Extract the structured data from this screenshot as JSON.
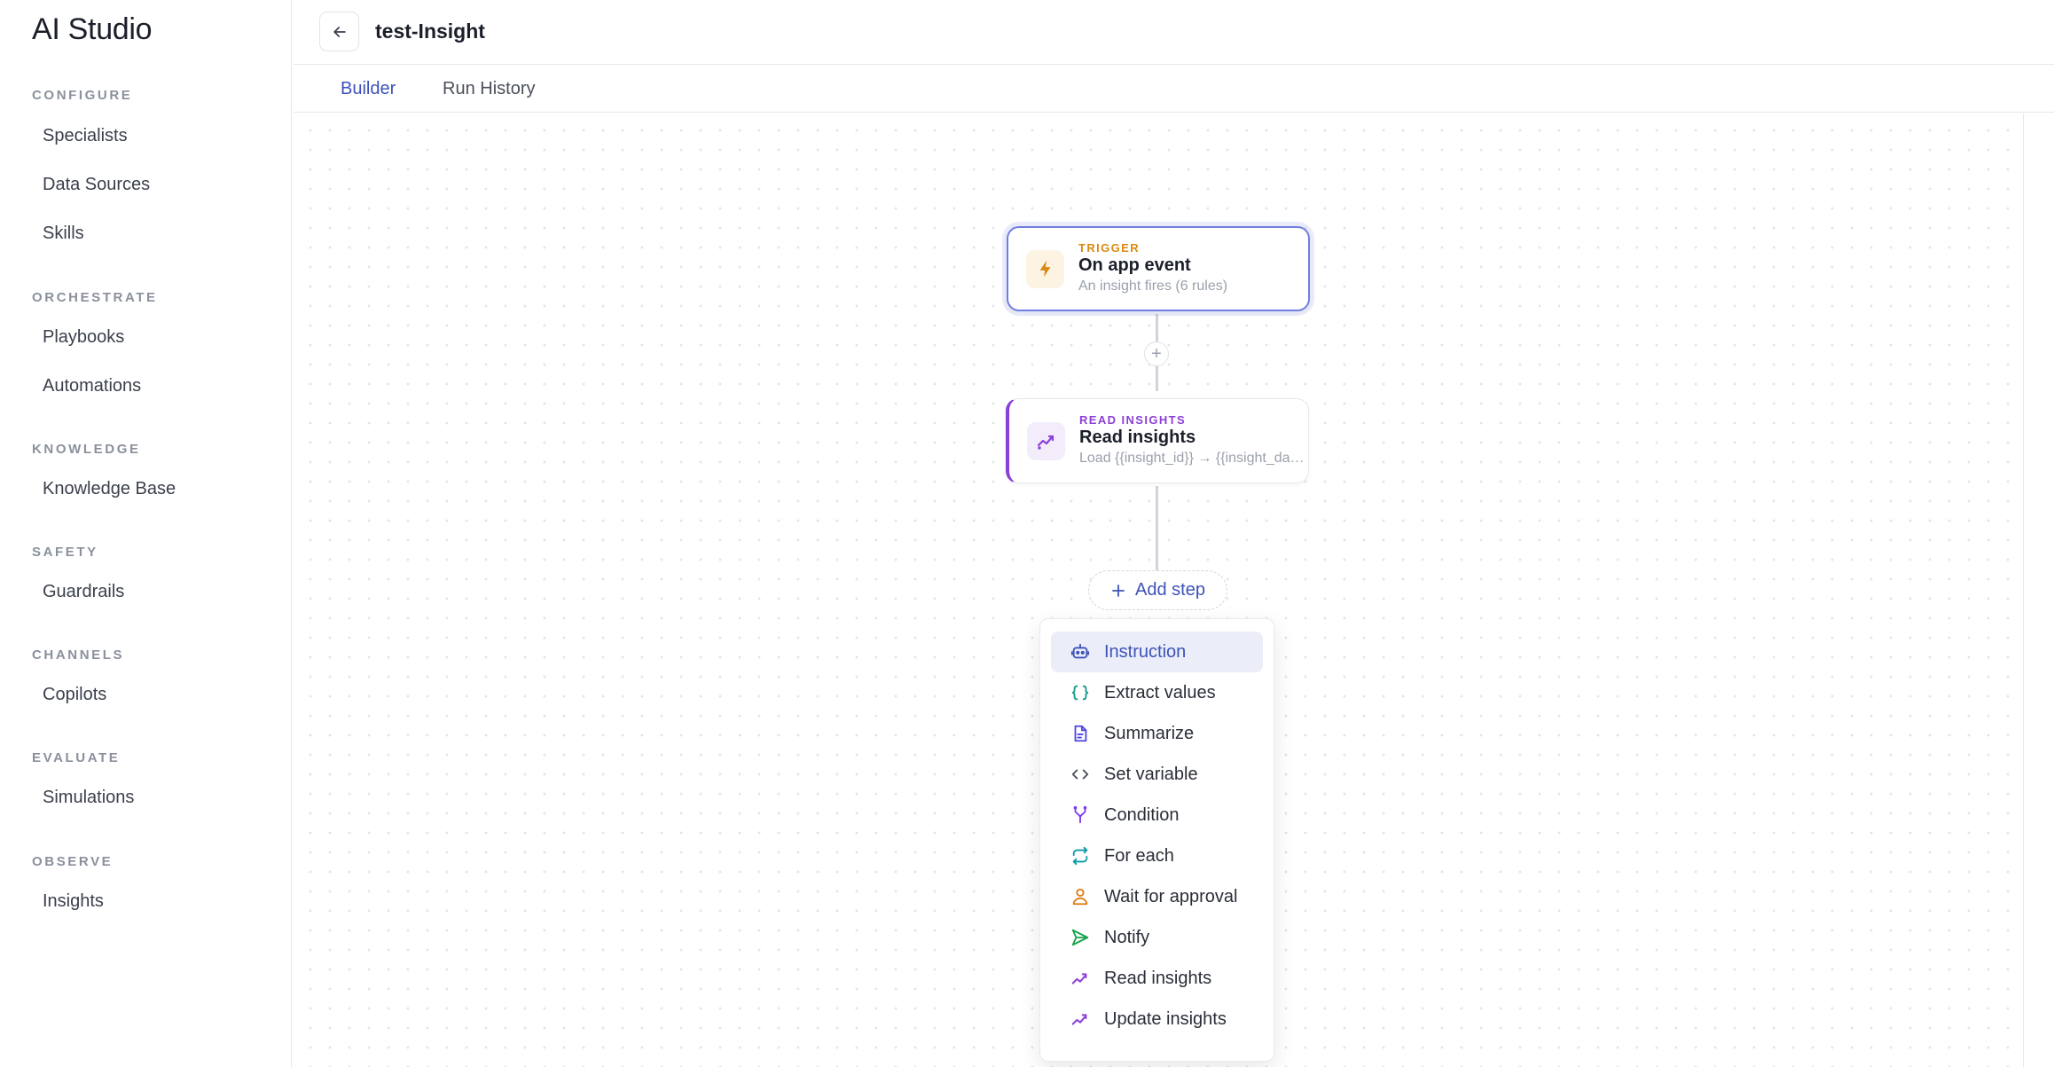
{
  "app": {
    "title": "AI Studio"
  },
  "sidebar": {
    "sections": [
      {
        "label": "CONFIGURE",
        "items": [
          "Specialists",
          "Data Sources",
          "Skills"
        ]
      },
      {
        "label": "ORCHESTRATE",
        "items": [
          "Playbooks",
          "Automations"
        ]
      },
      {
        "label": "KNOWLEDGE",
        "items": [
          "Knowledge Base"
        ]
      },
      {
        "label": "SAFETY",
        "items": [
          "Guardrails"
        ]
      },
      {
        "label": "CHANNELS",
        "items": [
          "Copilots"
        ]
      },
      {
        "label": "EVALUATE",
        "items": [
          "Simulations"
        ]
      },
      {
        "label": "OBSERVE",
        "items": [
          "Insights"
        ]
      }
    ]
  },
  "header": {
    "title": "test-Insight",
    "back_icon": "arrow-left-icon"
  },
  "tabs": [
    {
      "label": "Builder",
      "active": true
    },
    {
      "label": "Run History",
      "active": false
    }
  ],
  "flow": {
    "trigger": {
      "kind": "TRIGGER",
      "name": "On app event",
      "description": "An insight fires (6 rules)",
      "icon": "bolt-icon",
      "color": "#d98a13"
    },
    "step": {
      "kind": "READ INSIGHTS",
      "name": "Read insights",
      "description": "Load {{insight_id}} → {{insight_data}}",
      "icon": "trend-icon",
      "color": "#8b3fd9"
    },
    "connector_plus": "+",
    "add_step_label": "Add step"
  },
  "step_menu": {
    "items": [
      {
        "label": "Instruction",
        "icon": "robot-icon",
        "color": "#3d52b8",
        "selected": true
      },
      {
        "label": "Extract values",
        "icon": "braces-icon",
        "color": "#129a8a"
      },
      {
        "label": "Summarize",
        "icon": "document-icon",
        "color": "#4f46e5"
      },
      {
        "label": "Set variable",
        "icon": "code-icon",
        "color": "#4a4f5b"
      },
      {
        "label": "Condition",
        "icon": "branch-icon",
        "color": "#7c3aed"
      },
      {
        "label": "For each",
        "icon": "repeat-icon",
        "color": "#0e9aa7"
      },
      {
        "label": "Wait for approval",
        "icon": "person-icon",
        "color": "#e07b12"
      },
      {
        "label": "Notify",
        "icon": "send-icon",
        "color": "#16a34a"
      },
      {
        "label": "Read insights",
        "icon": "trend-icon",
        "color": "#8b3fd9"
      },
      {
        "label": "Update insights",
        "icon": "trend-icon",
        "color": "#8b3fd9"
      }
    ]
  }
}
